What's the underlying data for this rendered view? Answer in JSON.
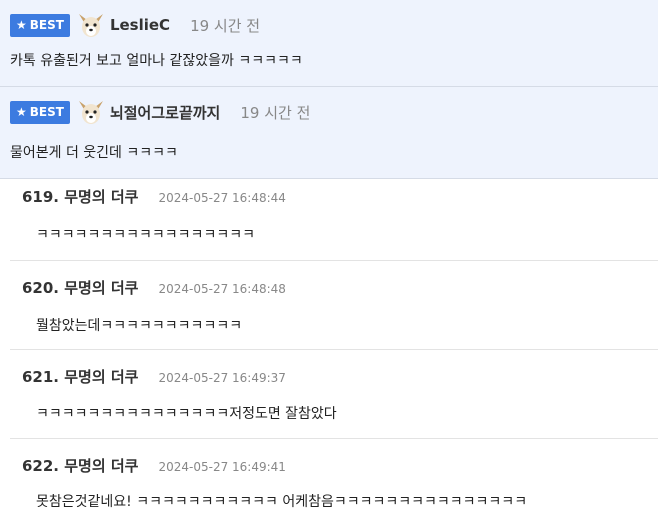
{
  "best": [
    {
      "badge": "BEST",
      "nick": "LeslieC",
      "ago": "19 시간 전",
      "text": "카톡 유출된거 보고 얼마나 같잖았을까 ㅋㅋㅋㅋㅋ"
    },
    {
      "badge": "BEST",
      "nick": "뇌절어그로끝까지",
      "ago": "19 시간 전",
      "text": "물어본게 더 웃긴데 ㅋㅋㅋㅋ"
    }
  ],
  "comments": [
    {
      "name": "619. 무명의 더쿠",
      "time": "2024-05-27 16:48:44",
      "text": "ㅋㅋㅋㅋㅋㅋㅋㅋㅋㅋㅋㅋㅋㅋㅋㅋㅋ"
    },
    {
      "name": "620. 무명의 더쿠",
      "time": "2024-05-27 16:48:48",
      "text": "뭘참았는데ㅋㅋㅋㅋㅋㅋㅋㅋㅋㅋㅋ"
    },
    {
      "name": "621. 무명의 더쿠",
      "time": "2024-05-27 16:49:37",
      "text": "ㅋㅋㅋㅋㅋㅋㅋㅋㅋㅋㅋㅋㅋㅋㅋ저정도면 잘참았다"
    },
    {
      "name": "622. 무명의 더쿠",
      "time": "2024-05-27 16:49:41",
      "text": "못참은것같네요! ㅋㅋㅋㅋㅋㅋㅋㅋㅋㅋㅋ 어케참음ㅋㅋㅋㅋㅋㅋㅋㅋㅋㅋㅋㅋㅋㅋㅋ"
    }
  ]
}
